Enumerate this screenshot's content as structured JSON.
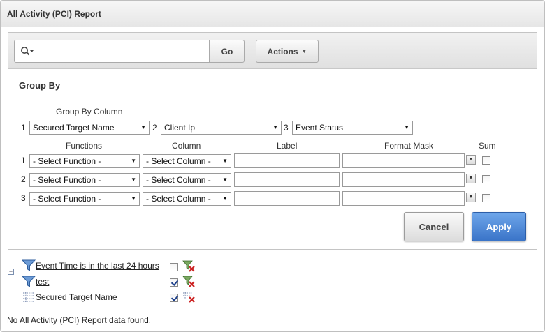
{
  "region": {
    "title": "All Activity (PCI) Report"
  },
  "toolbar": {
    "search_value": "",
    "go_label": "Go",
    "actions_label": "Actions"
  },
  "group_by": {
    "heading": "Group By",
    "column_header": "Group By Column",
    "columns": [
      {
        "num": "1",
        "value": "Secured Target Name"
      },
      {
        "num": "2",
        "value": "Client Ip"
      },
      {
        "num": "3",
        "value": "Event Status"
      }
    ],
    "fn_headers": {
      "functions": "Functions",
      "column": "Column",
      "label": "Label",
      "format_mask": "Format Mask",
      "sum": "Sum"
    },
    "rows": [
      {
        "num": "1",
        "function": "- Select Function -",
        "column": "- Select Column -",
        "label": "",
        "format_mask": "",
        "sum": false
      },
      {
        "num": "2",
        "function": "- Select Function -",
        "column": "- Select Column -",
        "label": "",
        "format_mask": "",
        "sum": false
      },
      {
        "num": "3",
        "function": "- Select Function -",
        "column": "- Select Column -",
        "label": "",
        "format_mask": "",
        "sum": false
      }
    ],
    "cancel_label": "Cancel",
    "apply_label": "Apply"
  },
  "filters": [
    {
      "text": "Event Time is in the last 24 hours",
      "enabled": false,
      "icon": "filter-icon",
      "link": true
    },
    {
      "text": "test",
      "enabled": true,
      "icon": "filter-icon",
      "link": true
    },
    {
      "text": "Secured Target Name",
      "enabled": true,
      "icon": "group-by-icon",
      "link": false
    }
  ],
  "no_data": "No All Activity (PCI) Report data found.",
  "colors": {
    "apply": "#3a74c8",
    "filter_funnel": "#5a8fd0",
    "remove_x": "#cc2222"
  }
}
